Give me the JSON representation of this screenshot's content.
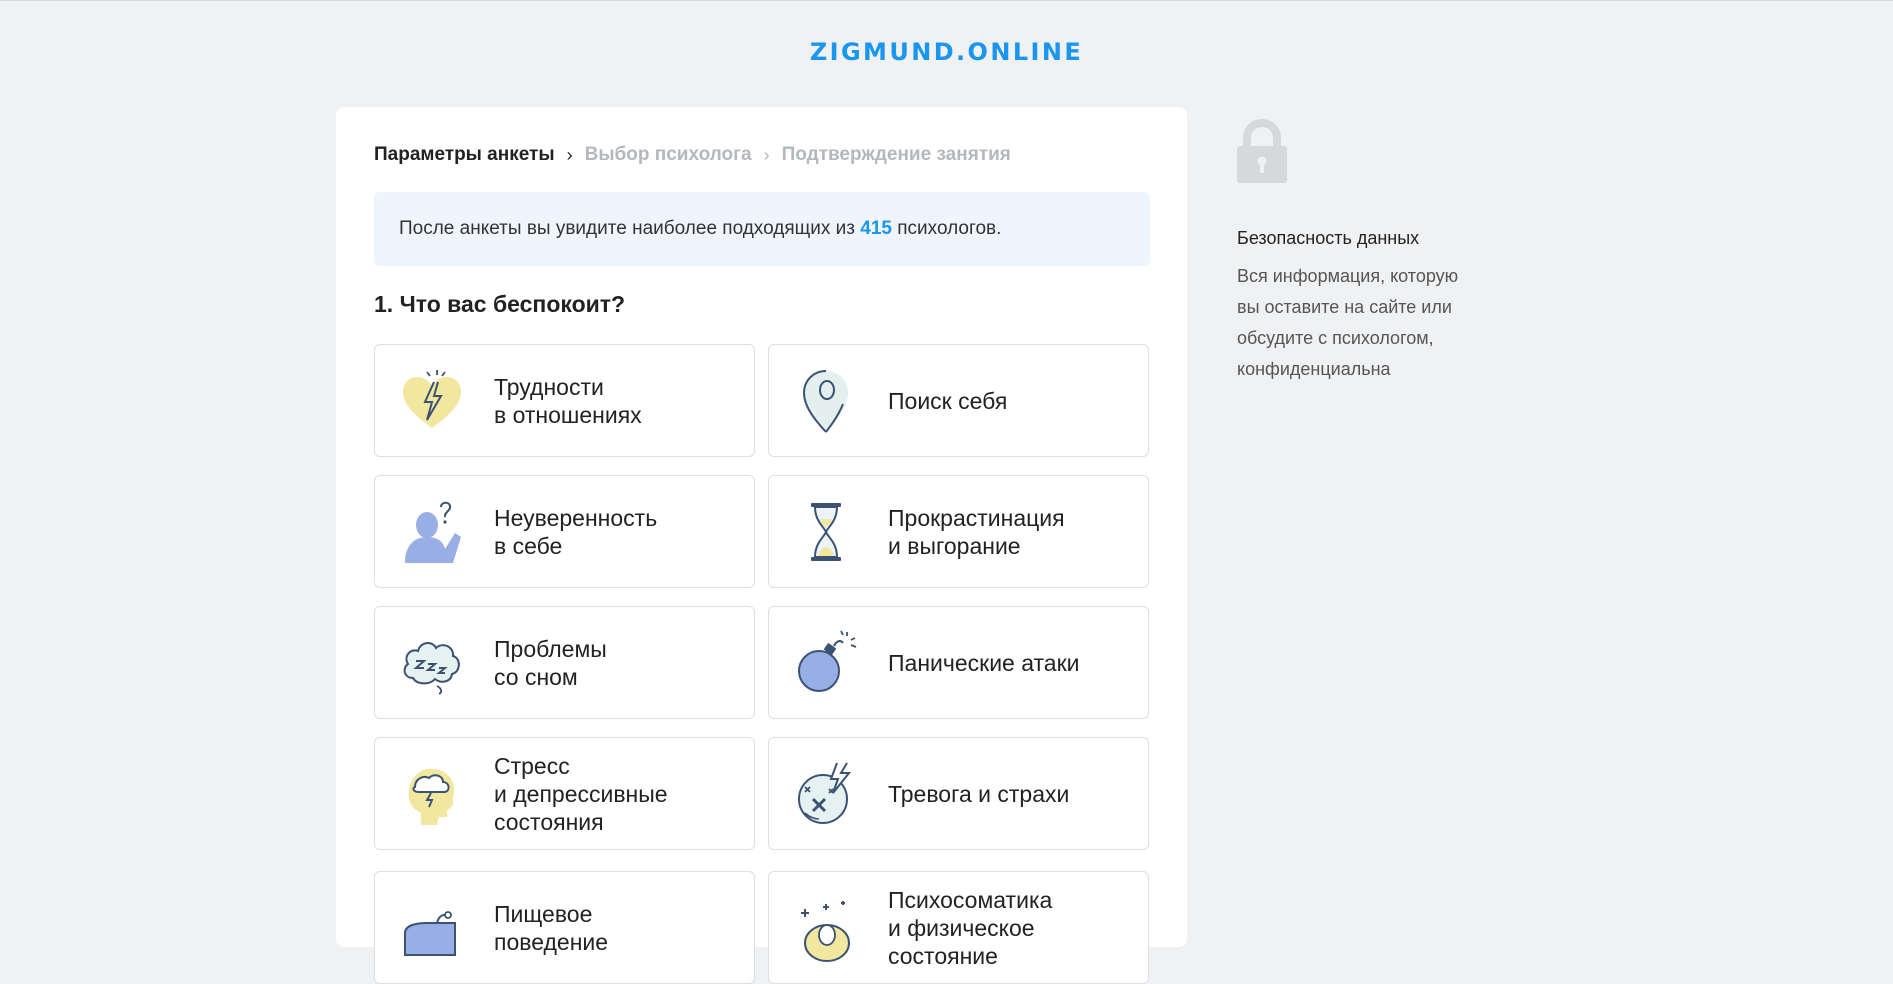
{
  "header": {
    "logo": "ZIGMUND.ONLINE"
  },
  "breadcrumb": {
    "steps": [
      "Параметры анкеты",
      "Выбор психолога",
      "Подтверждение занятия"
    ],
    "separator": "›"
  },
  "info": {
    "before": "После анкеты вы увидите наиболее подходящих из",
    "count": "415",
    "after": "психологов."
  },
  "question": "1. Что вас беспокоит?",
  "options": [
    {
      "icon": "broken-heart-icon",
      "lines": [
        "Трудности",
        "в отношениях"
      ]
    },
    {
      "icon": "location-pin-icon",
      "lines": [
        "Поиск себя"
      ]
    },
    {
      "icon": "person-question-icon",
      "lines": [
        "Неуверенность",
        "в себе"
      ]
    },
    {
      "icon": "hourglass-icon",
      "lines": [
        "Прокрастинация",
        "и выгорание"
      ]
    },
    {
      "icon": "sleep-cloud-icon",
      "lines": [
        "Проблемы",
        "со сном"
      ]
    },
    {
      "icon": "bomb-icon",
      "lines": [
        "Панические атаки"
      ]
    },
    {
      "icon": "storm-head-icon",
      "lines": [
        "Стресс",
        "и депрессивные",
        "состояния"
      ]
    },
    {
      "icon": "anxiety-ball-icon",
      "lines": [
        "Тревога и страхи"
      ]
    },
    {
      "icon": "food-icon",
      "lines": [
        "Пищевое",
        "поведение"
      ]
    },
    {
      "icon": "sparkles-body-icon",
      "lines": [
        "Психосоматика",
        "и физическое",
        "состояние"
      ]
    }
  ],
  "sidebar": {
    "title": "Безопасность данных",
    "text_lines": [
      "Вся информация, которую",
      "вы оставите на сайте или",
      "обсудите с психологом,",
      "конфиденциальна"
    ]
  },
  "colors": {
    "accent": "#1a96f0",
    "icon_blue": "#9aaee6",
    "icon_yellow": "#f2e79e",
    "icon_stroke": "#3b5274"
  }
}
